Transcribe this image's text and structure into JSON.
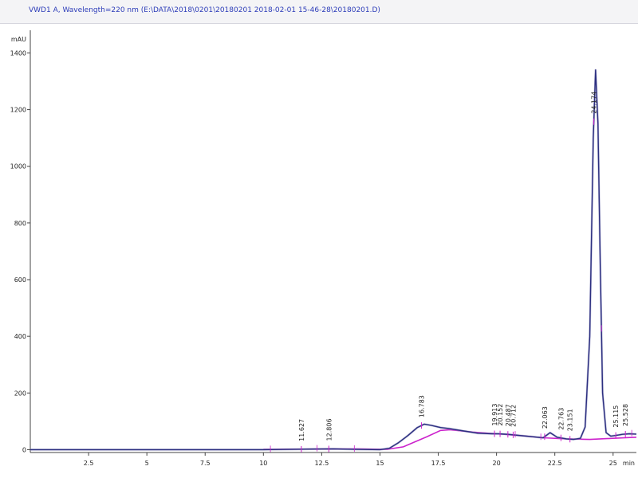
{
  "header": {
    "title": "VWD1 A, Wavelength=220 nm (E:\\DATA\\2018\\0201\\20180201 2018-02-01 15-46-28\\20180201.D)"
  },
  "chart_data": {
    "type": "line",
    "title": "VWD1 A, Wavelength=220 nm (E:\\DATA\\2018\\0201\\20180201 2018-02-01 15-46-28\\20180201.D)",
    "ylabel": "mAU",
    "xlabel": "min",
    "xlim": [
      0,
      26
    ],
    "ylim": [
      -10,
      1480
    ],
    "grid": false,
    "legend": "none",
    "x_ticks": [
      2.5,
      5,
      7.5,
      10,
      12.5,
      15,
      17.5,
      20,
      22.5,
      25
    ],
    "x_tick_labels": [
      "2.5",
      "5",
      "7.5",
      "10",
      "12.5",
      "15",
      "17.5",
      "20",
      "22.5",
      "25"
    ],
    "y_ticks": [
      0,
      200,
      400,
      600,
      800,
      1000,
      1200,
      1400
    ],
    "y_tick_labels": [
      "0",
      "200",
      "400",
      "600",
      "800",
      "1000",
      "1200",
      "1400"
    ],
    "colors": {
      "signal": "#2c2f80",
      "signal_peak": "#9090c0",
      "baseline": "#cc22cc",
      "marker": "#cc22cc",
      "text": "#222222"
    },
    "series": [
      {
        "role": "signal",
        "x": [
          0,
          2.5,
          5,
          7.5,
          10,
          11,
          12,
          13,
          14,
          15,
          15.4,
          15.8,
          16.2,
          16.6,
          16.9,
          17.2,
          17.6,
          18,
          18.6,
          19.2,
          19.8,
          20.1,
          20.5,
          21,
          21.5,
          22,
          22.3,
          22.6,
          23,
          23.3,
          23.6,
          23.8,
          24.0,
          24.15,
          24.25,
          24.35,
          24.45,
          24.55,
          24.7,
          24.9,
          25.1,
          25.4,
          25.7,
          26
        ],
        "y": [
          0,
          0,
          0,
          0,
          0,
          1,
          2,
          3,
          1,
          0,
          5,
          25,
          50,
          78,
          90,
          86,
          78,
          74,
          66,
          58,
          56,
          56,
          54,
          50,
          46,
          42,
          60,
          44,
          38,
          36,
          40,
          80,
          400,
          1100,
          1340,
          1150,
          650,
          200,
          60,
          48,
          50,
          54,
          56,
          55
        ]
      },
      {
        "role": "baseline",
        "x": [
          10,
          12,
          14,
          15.3,
          16,
          17,
          17.6,
          18,
          19,
          20,
          21,
          22,
          23,
          24,
          25,
          26
        ],
        "y": [
          1,
          2,
          3,
          1,
          10,
          45,
          68,
          70,
          62,
          56,
          50,
          42,
          38,
          36,
          40,
          44
        ]
      }
    ],
    "peaks": [
      {
        "rt": 11.627,
        "label": "11.627"
      },
      {
        "rt": 12.806,
        "label": "12.806"
      },
      {
        "rt": 16.783,
        "label": "16.783"
      },
      {
        "rt": 19.913,
        "label": "19.913"
      },
      {
        "rt": 20.152,
        "label": "20.152"
      },
      {
        "rt": 20.487,
        "label": "20.487"
      },
      {
        "rt": 20.712,
        "label": "20.712"
      },
      {
        "rt": 22.063,
        "label": "22.063"
      },
      {
        "rt": 22.763,
        "label": "22.763"
      },
      {
        "rt": 23.151,
        "label": "23.151"
      },
      {
        "rt": 24.174,
        "label": "24.174"
      },
      {
        "rt": 25.115,
        "label": "25.115"
      },
      {
        "rt": 25.528,
        "label": "25.528"
      }
    ]
  }
}
